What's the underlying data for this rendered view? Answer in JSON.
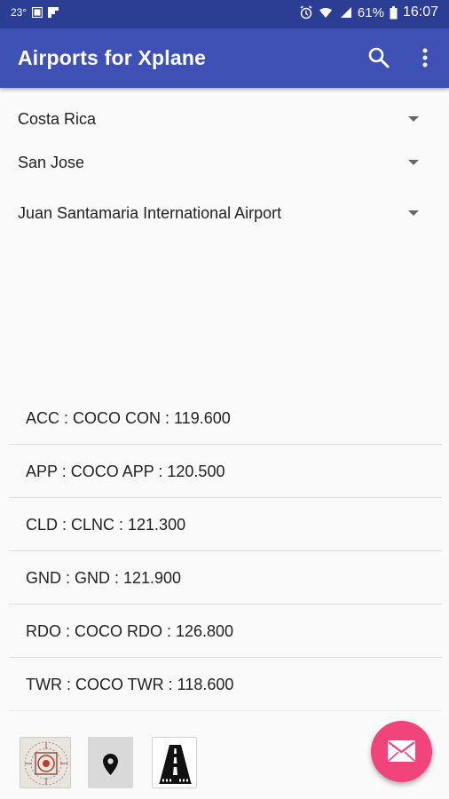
{
  "status_bar": {
    "temperature": "23°",
    "battery": "61%",
    "time": "16:07"
  },
  "app_bar": {
    "title": "Airports for Xplane",
    "search_icon": "search-icon",
    "overflow_icon": "more-vert-icon"
  },
  "selectors": {
    "country": "Costa Rica",
    "city": "San Jose",
    "airport": "Juan Santamaria International Airport"
  },
  "frequencies": [
    {
      "text": "ACC : COCO CON : 119.600"
    },
    {
      "text": "APP : COCO APP : 120.500"
    },
    {
      "text": "CLD : CLNC : 121.300"
    },
    {
      "text": "GND : GND : 121.900"
    },
    {
      "text": "RDO : COCO RDO : 126.800"
    },
    {
      "text": "TWR : COCO TWR : 118.600"
    }
  ],
  "actions": {
    "radar_icon": "radar-icon",
    "map_icon": "map-pin-icon",
    "runway_icon": "runway-icon",
    "fab_icon": "email-icon"
  },
  "colors": {
    "primary": "#3f51b5",
    "status_bar": "#2c3e94",
    "fab": "#f0447a"
  }
}
